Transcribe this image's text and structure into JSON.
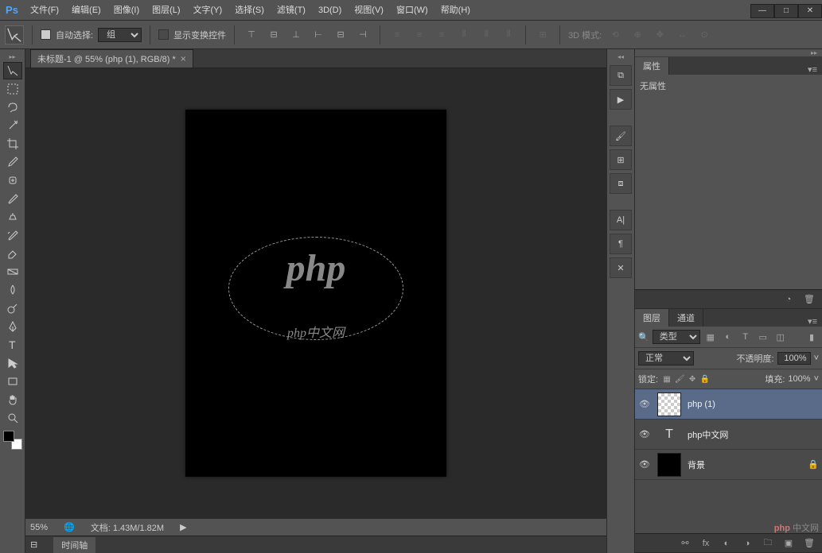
{
  "app": {
    "logo": "Ps"
  },
  "menu": [
    "文件(F)",
    "编辑(E)",
    "图像(I)",
    "图层(L)",
    "文字(Y)",
    "选择(S)",
    "滤镜(T)",
    "3D(D)",
    "视图(V)",
    "窗口(W)",
    "帮助(H)"
  ],
  "window_controls": {
    "min": "—",
    "max": "□",
    "close": "✕"
  },
  "options": {
    "auto_select": "自动选择:",
    "group": "组",
    "show_transform": "显示变换控件",
    "mode_3d": "3D 模式:"
  },
  "document": {
    "tab_title": "未标题-1 @ 55% (php (1), RGB/8) *",
    "php_text": "php",
    "php_cn": "php中文网",
    "zoom": "55%",
    "doc_size": "文档: 1.43M/1.82M",
    "timeline": "时间轴"
  },
  "panels": {
    "properties": {
      "title": "属性",
      "empty": "无属性"
    },
    "layers": {
      "tab_layers": "图层",
      "tab_channels": "通道",
      "filter_type": "类型",
      "blend_mode": "正常",
      "opacity_label": "不透明度:",
      "opacity_value": "100%",
      "lock_label": "锁定:",
      "fill_label": "填充:",
      "fill_value": "100%",
      "items": [
        {
          "name": "php (1)",
          "type": "image",
          "selected": true
        },
        {
          "name": "php中文网",
          "type": "text",
          "selected": false
        },
        {
          "name": "背景",
          "type": "bg",
          "selected": false,
          "locked": true
        }
      ]
    }
  },
  "watermark": {
    "brand": "php",
    "text": " 中文网"
  }
}
